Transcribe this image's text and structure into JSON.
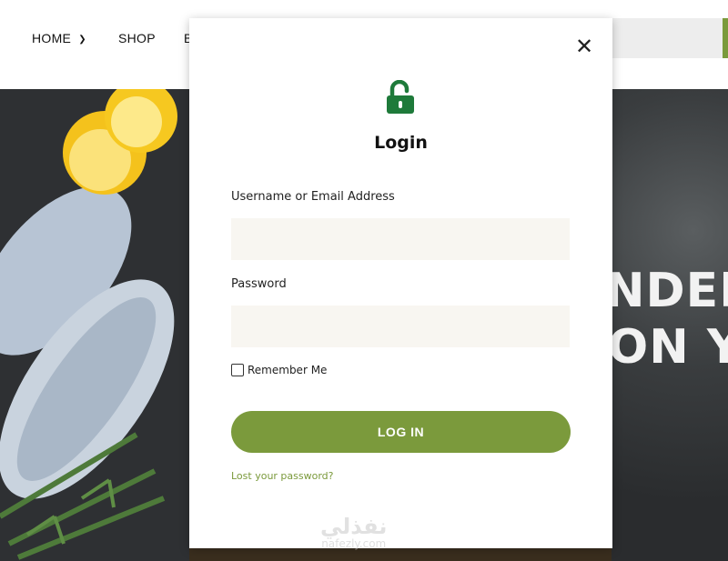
{
  "nav": {
    "home": "HOME",
    "shop": "SHOP",
    "partial_item": "B"
  },
  "hero": {
    "line1": "NDER",
    "line2": "ON YO"
  },
  "modal": {
    "title": "Login",
    "username_label": "Username or Email Address",
    "username_value": "",
    "password_label": "Password",
    "password_value": "",
    "remember_label": "Remember Me",
    "remember_checked": false,
    "login_button": "LOG IN",
    "lost_password": "Lost your password?"
  },
  "watermark": {
    "arabic": "نفذلي",
    "latin": "nafezly.com"
  },
  "icons": {
    "close": "close-icon",
    "lock": "unlocked-padlock-icon",
    "chevron": "chevron-down-icon"
  },
  "colors": {
    "accent": "#7b9a3c",
    "lock": "#1e7a3a",
    "input_bg": "#f8f6f1"
  }
}
